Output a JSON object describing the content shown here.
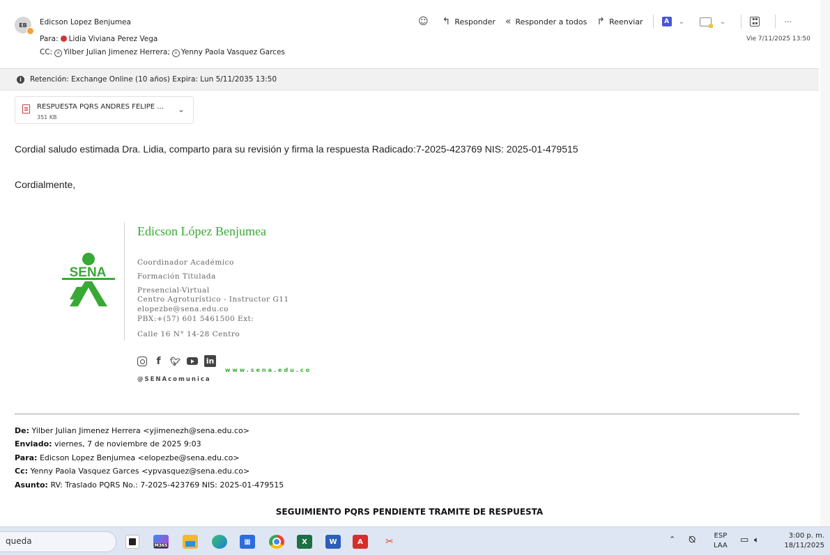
{
  "header": {
    "avatar_initials": "EB",
    "sender": "Edicson Lopez Benjumea",
    "to_label": "Para:",
    "to_name": "Lidia Viviana Perez Vega",
    "cc_label": "CC:",
    "cc_1": "Yilber Julian Jimenez Herrera;",
    "cc_2": "Yenny Paola Vasquez Garces",
    "date": "Vie 7/11/2025 13:50"
  },
  "toolbar": {
    "reply": "Responder",
    "reply_all": "Responder a todos",
    "forward": "Reenviar",
    "more": "···"
  },
  "retention": {
    "text": "Retención: Exchange Online (10 años) Expira: Lun 5/11/2035 13:50"
  },
  "attachment": {
    "name": "RESPUESTA PQRS ANDRES FELIPE ...",
    "size": "351 KB"
  },
  "body": {
    "message": "Cordial saludo estimada Dra. Lidia, comparto para su revisión y firma la respuesta  Radicado:7-2025-423769 NIS: 2025-01-479515",
    "closing": "Cordialmente,"
  },
  "signature": {
    "logo_text": "SENA",
    "name": "Edicson López Benjumea",
    "role": "Coordinador Académico",
    "area": "Formación Titulada",
    "mode": "Presencial-Virtual",
    "center": "Centro Agroturístico - Instructor G11",
    "email": "elopezbe@sena.edu.co",
    "pbx": "PBX:+(57) 601 5461500 Ext:",
    "address": "Calle 16 N° 14-28 Centro",
    "website": "www.sena.edu.co",
    "handle": "@SENAcomunica"
  },
  "forwarded": {
    "from_label": "De:",
    "from": "Yilber Julian Jimenez Herrera <yjimenezh@sena.edu.co>",
    "sent_label": "Enviado:",
    "sent": "viernes, 7 de noviembre de 2025 9:03",
    "to_label": "Para:",
    "to": "Edicson Lopez Benjumea <elopezbe@sena.edu.co>",
    "cc_label": "Cc:",
    "cc": "Yenny Paola Vasquez Garces <ypvasquez@sena.edu.co>",
    "subject_label": "Asunto:",
    "subject": "RV: Traslado PQRS No.: 7-2025-423769 NIS: 2025-01-479515",
    "heading": "SEGUIMIENTO PQRS PENDIENTE TRAMITE DE RESPUESTA"
  },
  "taskbar": {
    "search_text": "queda",
    "lang_1": "ESP",
    "lang_2": "LAA",
    "time": "3:00 p. m.",
    "date": "18/11/2025",
    "m365_label": "M365"
  }
}
